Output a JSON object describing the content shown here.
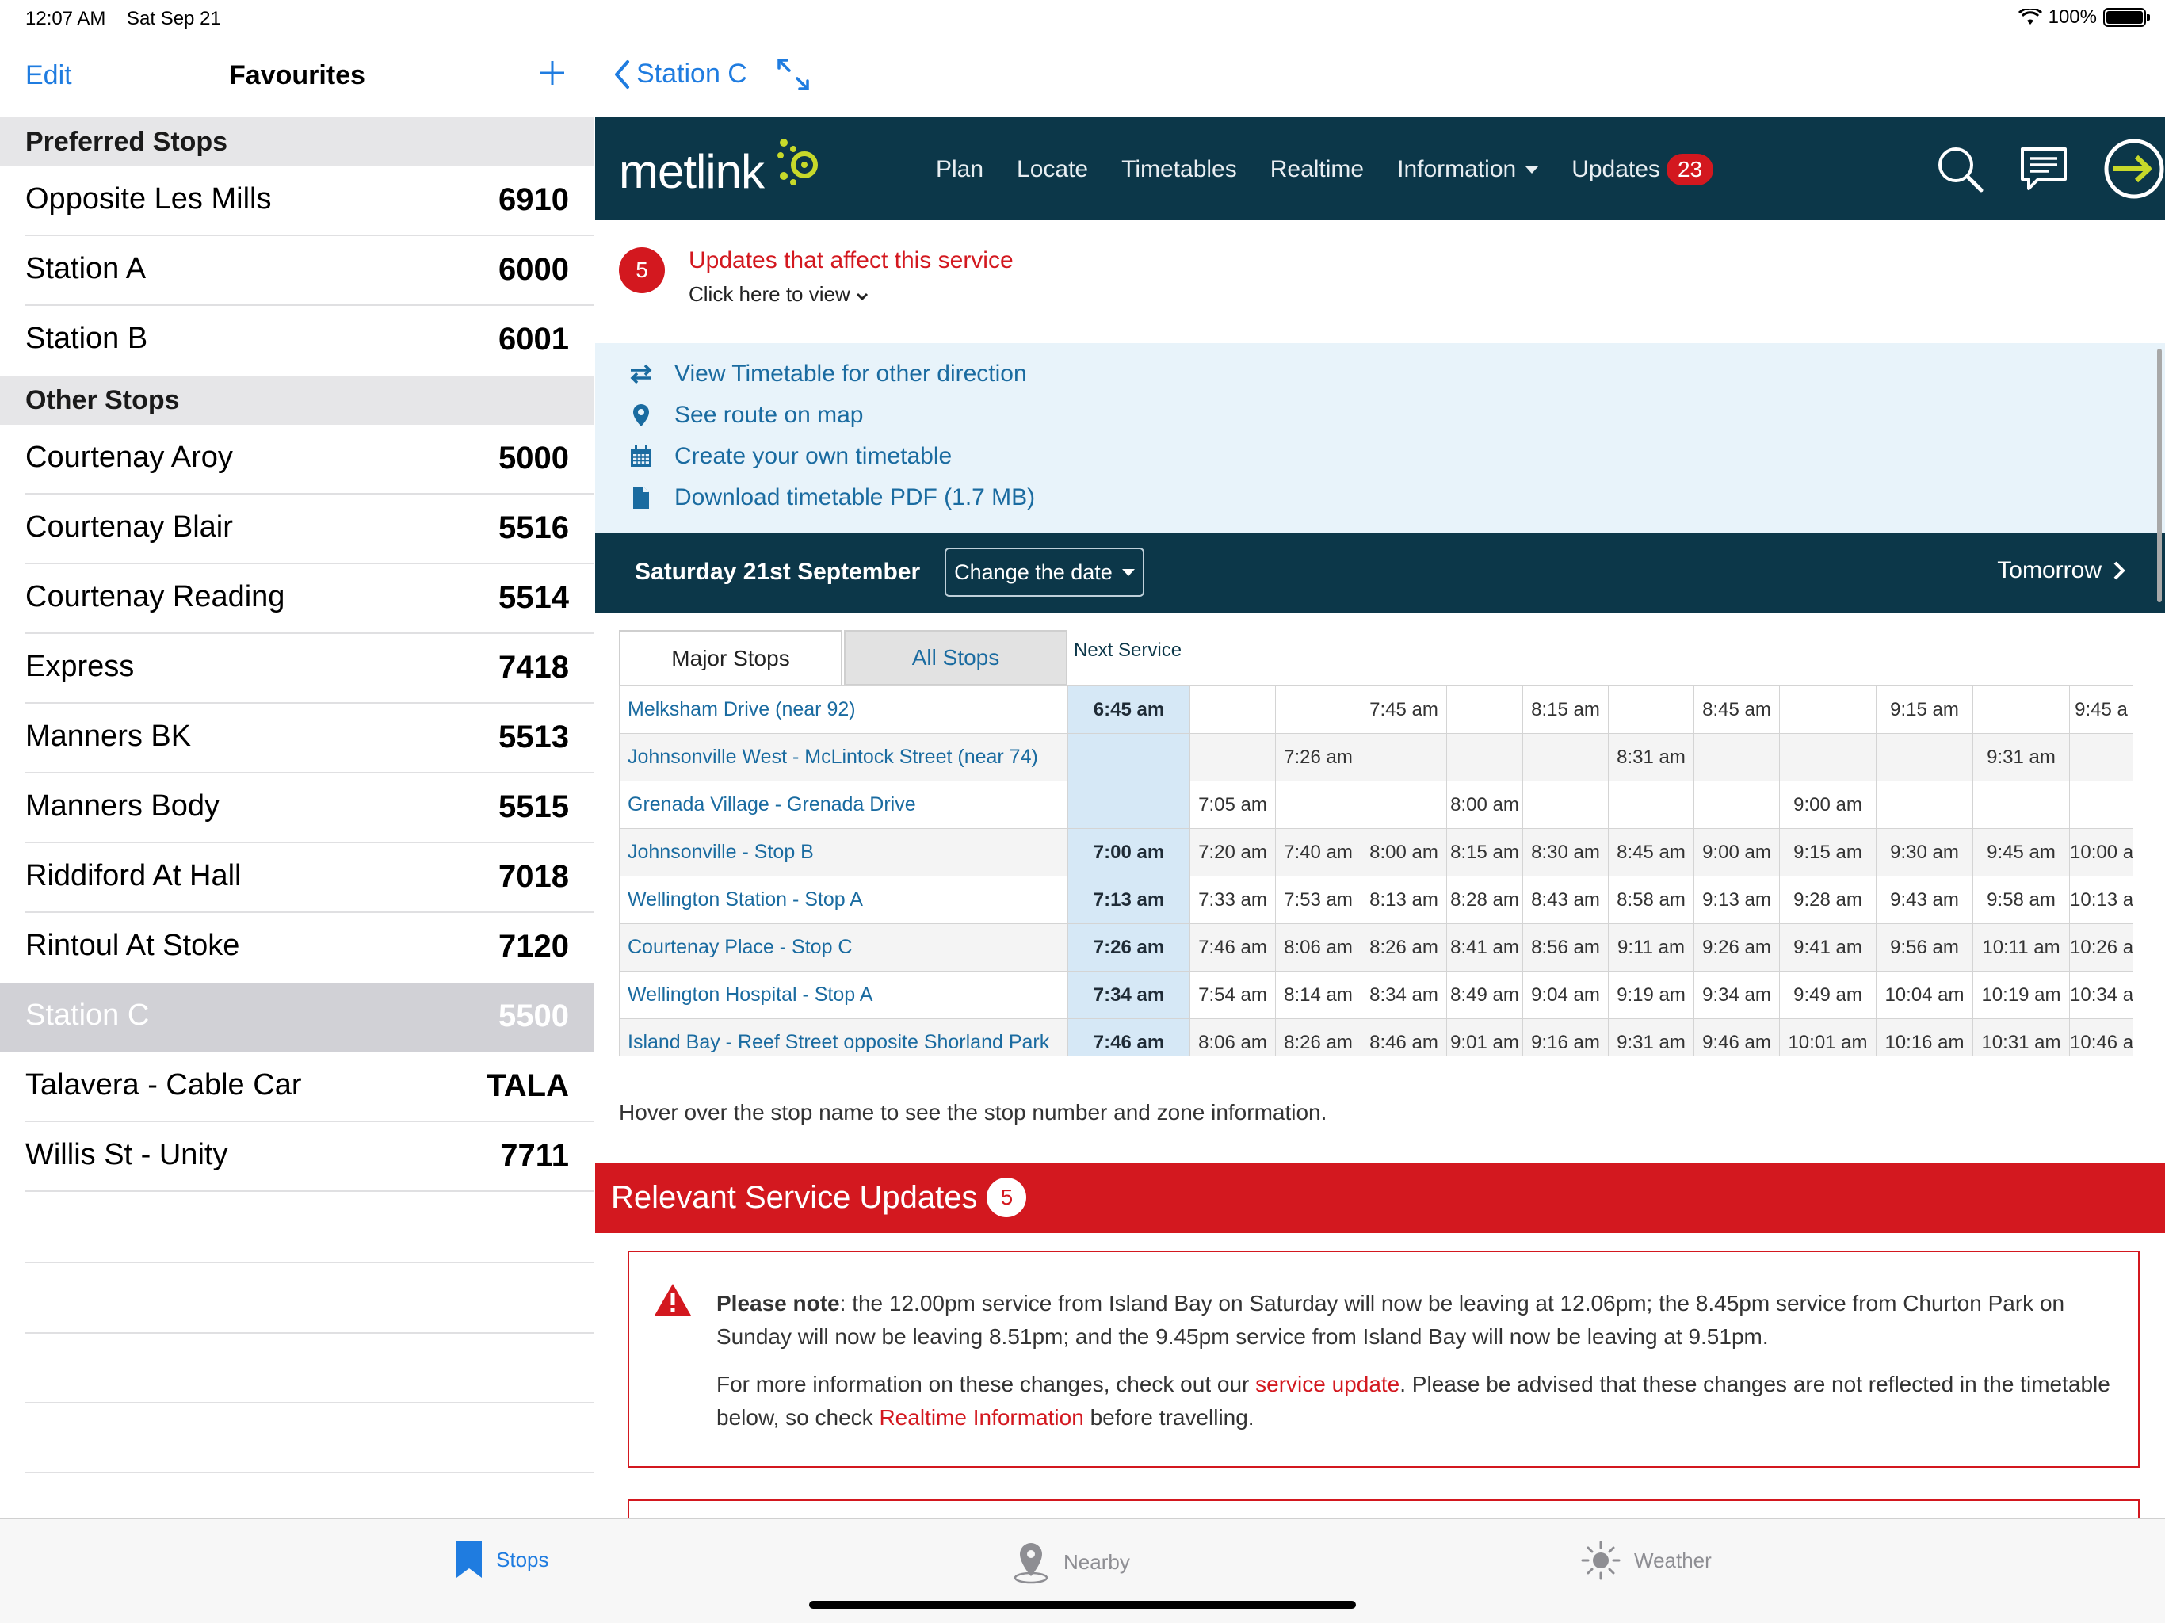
{
  "status_bar": {
    "time": "12:07 AM",
    "date": "Sat Sep 21",
    "battery": "100%"
  },
  "sidebar": {
    "edit_label": "Edit",
    "title": "Favourites",
    "add_icon": "plus-icon",
    "preferred_header": "Preferred Stops",
    "preferred": [
      {
        "name": "Opposite Les Mills",
        "code": "6910"
      },
      {
        "name": "Station A",
        "code": "6000"
      },
      {
        "name": "Station B",
        "code": "6001"
      }
    ],
    "other_header": "Other Stops",
    "other": [
      {
        "name": "Courtenay Aroy",
        "code": "5000"
      },
      {
        "name": "Courtenay Blair",
        "code": "5516"
      },
      {
        "name": "Courtenay Reading",
        "code": "5514"
      },
      {
        "name": "Express",
        "code": "7418"
      },
      {
        "name": "Manners BK",
        "code": "5513"
      },
      {
        "name": "Manners Body",
        "code": "5515"
      },
      {
        "name": "Riddiford At Hall",
        "code": "7018"
      },
      {
        "name": "Rintoul At Stoke",
        "code": "7120"
      },
      {
        "name": "Station C",
        "code": "5500",
        "selected": true
      },
      {
        "name": "Talavera - Cable Car",
        "code": "TALA"
      },
      {
        "name": "Willis St - Unity",
        "code": "7711"
      }
    ]
  },
  "detail_nav": {
    "back_label": "Station C"
  },
  "metlink": {
    "logo_text": "metlink",
    "nav": {
      "plan": "Plan",
      "locate": "Locate",
      "timetables": "Timetables",
      "realtime": "Realtime",
      "information": "Information",
      "updates": "Updates",
      "updates_count": "23"
    }
  },
  "updates_banner": {
    "count": "5",
    "title": "Updates that affect this service",
    "subtitle": "Click here to view"
  },
  "links": {
    "other_direction": "View Timetable for other direction",
    "route_map": "See route on map",
    "create_timetable": "Create your own timetable",
    "download_pdf": "Download timetable PDF (1.7 MB)"
  },
  "datebar": {
    "date": "Saturday 21st September",
    "change_label": "Change the date",
    "tomorrow_label": "Tomorrow"
  },
  "timetable": {
    "tab_major": "Major Stops",
    "tab_all": "All Stops",
    "next_service_label": "Next Service",
    "rows": [
      {
        "stop": "Melksham Drive (near 92)",
        "next": "6:45 am",
        "times": [
          "",
          "",
          "7:45 am",
          "",
          "8:15 am",
          "",
          "8:45 am",
          "",
          "9:15 am",
          "",
          "9:45 a"
        ]
      },
      {
        "stop": "Johnsonville West - McLintock Street (near 74)",
        "next": "",
        "times": [
          "",
          "7:26 am",
          "",
          "",
          "",
          "8:31 am",
          "",
          "",
          "",
          "9:31 am",
          ""
        ]
      },
      {
        "stop": "Grenada Village - Grenada Drive",
        "next": "",
        "times": [
          "7:05 am",
          "",
          "",
          "8:00 am",
          "",
          "",
          "",
          "9:00 am",
          "",
          "",
          ""
        ]
      },
      {
        "stop": "Johnsonville - Stop B",
        "next": "7:00 am",
        "times": [
          "7:20 am",
          "7:40 am",
          "8:00 am",
          "8:15 am",
          "8:30 am",
          "8:45 am",
          "9:00 am",
          "9:15 am",
          "9:30 am",
          "9:45 am",
          "10:00 a"
        ]
      },
      {
        "stop": "Wellington Station - Stop A",
        "next": "7:13 am",
        "times": [
          "7:33 am",
          "7:53 am",
          "8:13 am",
          "8:28 am",
          "8:43 am",
          "8:58 am",
          "9:13 am",
          "9:28 am",
          "9:43 am",
          "9:58 am",
          "10:13 a"
        ]
      },
      {
        "stop": "Courtenay Place - Stop C",
        "next": "7:26 am",
        "times": [
          "7:46 am",
          "8:06 am",
          "8:26 am",
          "8:41 am",
          "8:56 am",
          "9:11 am",
          "9:26 am",
          "9:41 am",
          "9:56 am",
          "10:11 am",
          "10:26 a"
        ]
      },
      {
        "stop": "Wellington Hospital - Stop A",
        "next": "7:34 am",
        "times": [
          "7:54 am",
          "8:14 am",
          "8:34 am",
          "8:49 am",
          "9:04 am",
          "9:19 am",
          "9:34 am",
          "9:49 am",
          "10:04 am",
          "10:19 am",
          "10:34 a"
        ]
      },
      {
        "stop": "Island Bay - Reef Street opposite Shorland Park",
        "next": "7:46 am",
        "times": [
          "8:06 am",
          "8:26 am",
          "8:46 am",
          "9:01 am",
          "9:16 am",
          "9:31 am",
          "9:46 am",
          "10:01 am",
          "10:16 am",
          "10:31 am",
          "10:46 a"
        ]
      }
    ],
    "hover_note": "Hover over the stop name to see the stop number and zone information."
  },
  "service_updates": {
    "title": "Relevant Service Updates",
    "count": "5",
    "notice_bold": "Please note",
    "notice_text": ": the 12.00pm service from Island Bay on Saturday will now be leaving at 12.06pm; the 8.45pm service from Churton Park on Sunday will now be leaving 8.51pm; and the 9.45pm service from Island Bay will now be leaving at 9.51pm.",
    "more_prefix": "For more information on these changes, check out our ",
    "more_link": "service update",
    "more_middle": ". Please be advised that these changes are not reflected in the timetable below, so check ",
    "more_link2": "Realtime Information",
    "more_suffix": " before travelling."
  },
  "tabbar": {
    "stops": "Stops",
    "nearby": "Nearby",
    "weather": "Weather"
  },
  "colors": {
    "ios_blue": "#1f7ce0",
    "metlink_navy": "#0c3749",
    "alert_red": "#d3181f",
    "metlink_lime": "#c7d92a"
  }
}
